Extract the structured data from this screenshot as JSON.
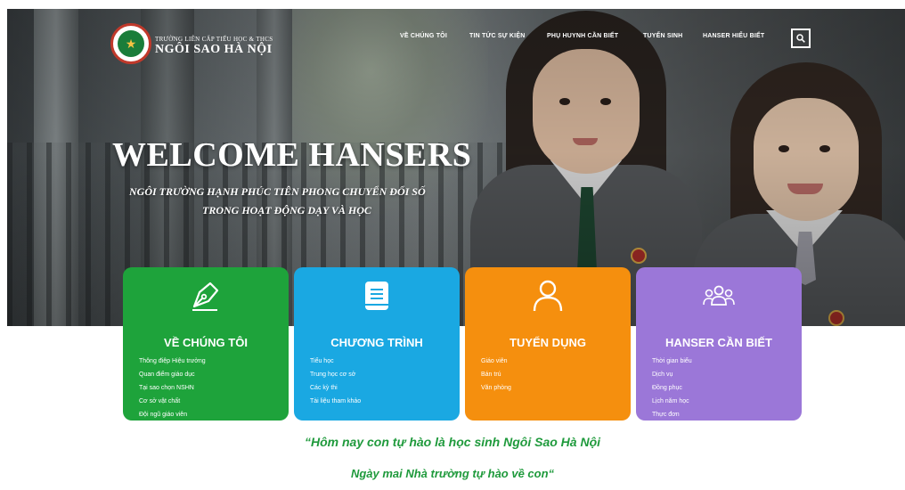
{
  "header": {
    "logo_icon": "school-star-logo-icon",
    "brand_small": "Trường liên cấp Tiểu học & THCS",
    "brand_name": "NGÔI SAO HÀ NỘI",
    "nav": [
      "VỀ CHÚNG TÔI",
      "TIN TỨC SỰ KIỆN",
      "PHỤ HUYNH CẦN BIẾT",
      "TUYỂN SINH",
      "HANSER HIỂU BIẾT"
    ],
    "search_icon": "search-icon"
  },
  "hero": {
    "title": "WELCOME HANSERS",
    "subtitle_line1": "NGÔI TRƯỜNG HẠNH PHÚC TIÊN PHONG CHUYỂN ĐỔI SỐ",
    "subtitle_line2": "TRONG HOẠT ĐỘNG DẠY VÀ HỌC"
  },
  "cards": [
    {
      "title": "VỀ CHÚNG TÔI",
      "icon": "pen-nib-icon",
      "color": "#1ea33b",
      "items": [
        "Thông điệp Hiệu trưởng",
        "Quan điểm giáo dục",
        "Tại sao chọn NSHN",
        "Cơ sở vật chất",
        "Đội ngũ giáo viên"
      ]
    },
    {
      "title": "CHƯƠNG TRÌNH",
      "icon": "book-icon",
      "color": "#1aa8e2",
      "items": [
        "Tiểu học",
        "Trung học cơ sở",
        "Các kỳ thi",
        "Tài liệu tham khảo"
      ]
    },
    {
      "title": "TUYỂN DỤNG",
      "icon": "user-icon",
      "color": "#f58f0e",
      "items": [
        "Giáo viên",
        "Bán trú",
        "Văn phòng"
      ]
    },
    {
      "title": "HANSER CẦN BIẾT",
      "icon": "users-group-icon",
      "color": "#9b77d8",
      "items": [
        "Thời gian biểu",
        "Dịch vụ",
        "Đồng phục",
        "Lịch năm học",
        "Thực đơn"
      ]
    }
  ],
  "quote": {
    "line1": "“Hôm nay con tự hào là học sinh Ngôi Sao Hà Nội",
    "line2": "Ngày mai Nhà trường tự hào về con“"
  }
}
